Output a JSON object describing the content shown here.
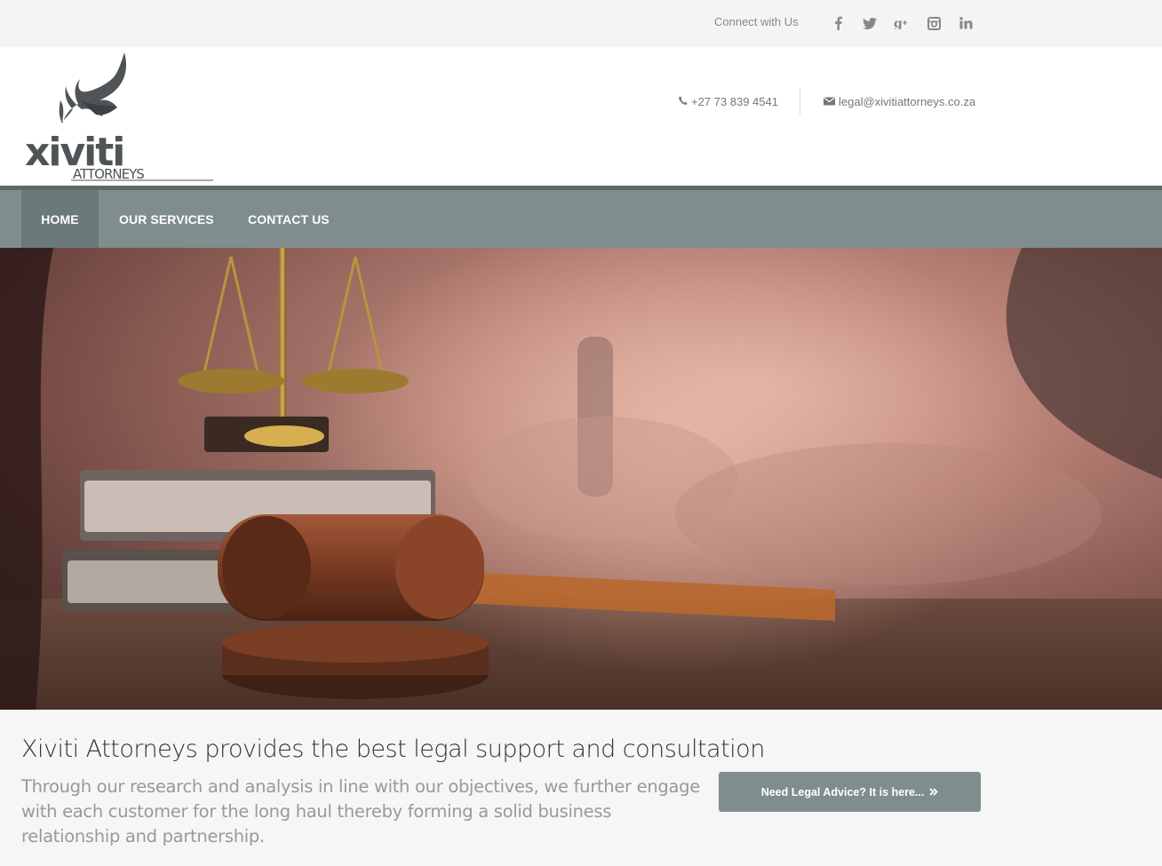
{
  "topbar": {
    "connect_label": "Connect with Us",
    "social": [
      {
        "icon": "facebook-icon",
        "glyph": "f"
      },
      {
        "icon": "twitter-icon",
        "glyph": "🐦"
      },
      {
        "icon": "google-plus-icon",
        "glyph": "g+"
      },
      {
        "icon": "instagram-icon",
        "glyph": "◙"
      },
      {
        "icon": "linkedin-icon",
        "glyph": "in"
      }
    ]
  },
  "header": {
    "logo_text": "xiviti",
    "logo_subtext": "ATTORNEYS",
    "phone": "+27 73 839 4541",
    "email": "legal@xivitiattorneys.co.za"
  },
  "nav": {
    "items": [
      {
        "label": "HOME"
      },
      {
        "label": "OUR SERVICES"
      },
      {
        "label": "CONTACT US"
      }
    ]
  },
  "main": {
    "headline": "Xiviti Attorneys provides the best legal support and consultation",
    "subtext": "Through our research and analysis in line with our objectives, we further engage with each customer for the long haul thereby forming a solid business relationship and partnership.",
    "cta_label": "Need Legal Advice? It is here...",
    "cta_icon": "double-chevron-right-icon"
  },
  "colors": {
    "nav_bg": "#7f8d8e",
    "nav_active": "#6c797a",
    "nav_border": "#5d6869",
    "cta_bg": "#7f8d8e"
  }
}
